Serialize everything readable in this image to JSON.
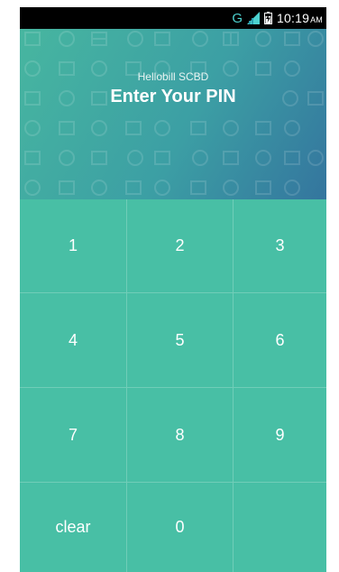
{
  "status_bar": {
    "network_type": "G",
    "time": "10:19",
    "ampm": "AM",
    "icons": [
      "signal-icon",
      "battery-icon"
    ]
  },
  "header": {
    "app_name": "Hellobill SCBD",
    "title": "Enter Your PIN",
    "gradient_colors": [
      "#47b6a0",
      "#34759e"
    ]
  },
  "keypad": {
    "keys": [
      "1",
      "2",
      "3",
      "4",
      "5",
      "6",
      "7",
      "8",
      "9",
      "clear",
      "0",
      ""
    ],
    "background": "#48bfa5"
  }
}
